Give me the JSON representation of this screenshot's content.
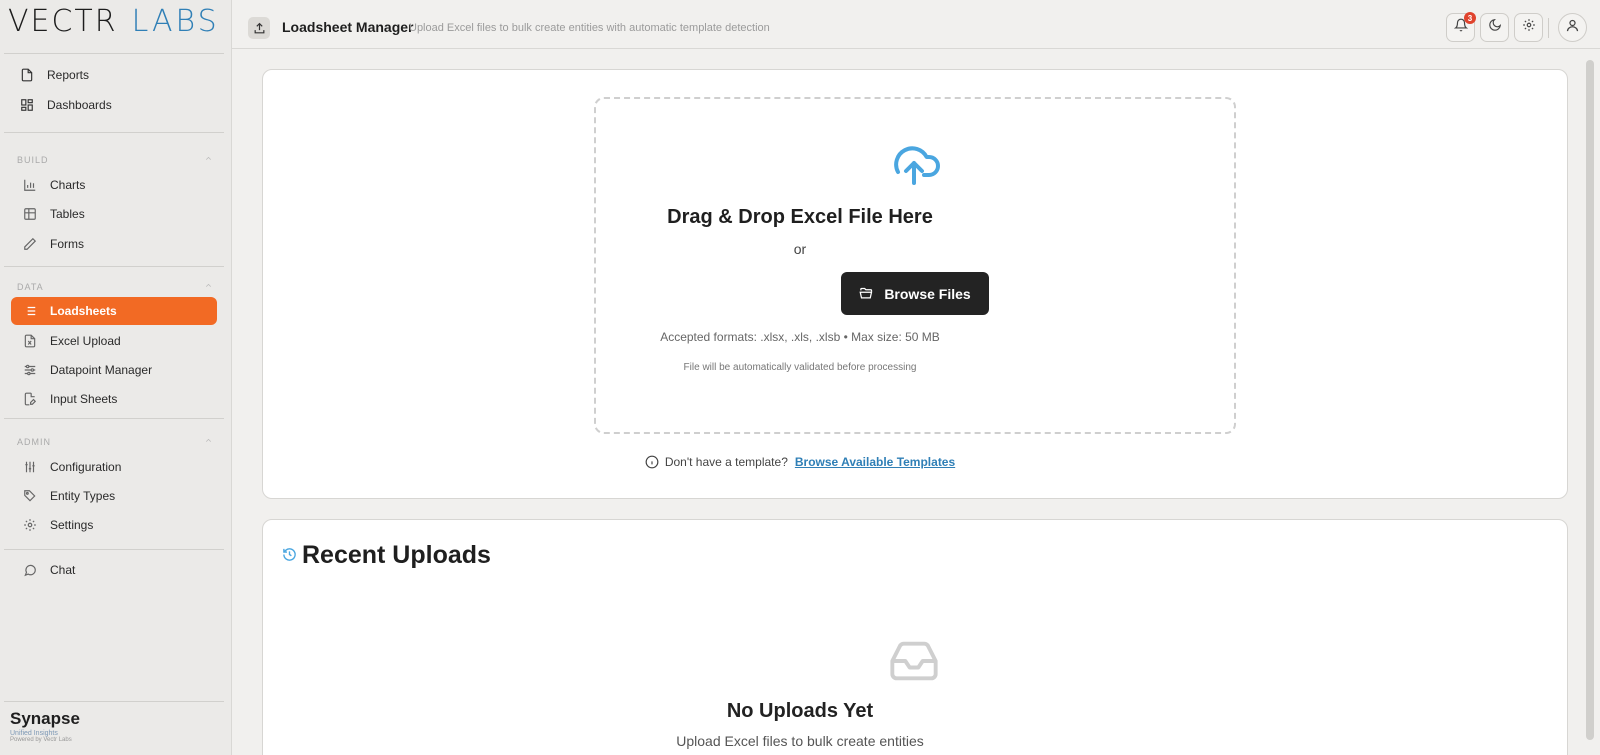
{
  "brand": {
    "logo_part1": "VECTR",
    "logo_part2": "LABS",
    "app_name": "Synapse",
    "tagline": "Unified Insights",
    "powered_by": "Powered by Vectr Labs"
  },
  "sidebar": {
    "top_items": [
      {
        "label": "Reports",
        "icon": "file-icon"
      },
      {
        "label": "Dashboards",
        "icon": "grid-icon"
      }
    ],
    "sections": [
      {
        "title": "BUILD",
        "items": [
          {
            "label": "Charts",
            "icon": "bar-chart-icon"
          },
          {
            "label": "Tables",
            "icon": "table-icon"
          },
          {
            "label": "Forms",
            "icon": "pencil-icon"
          }
        ]
      },
      {
        "title": "DATA",
        "items": [
          {
            "label": "Loadsheets",
            "icon": "list-icon",
            "active": true
          },
          {
            "label": "Excel Upload",
            "icon": "excel-file-icon"
          },
          {
            "label": "Datapoint Manager",
            "icon": "sliders-icon"
          },
          {
            "label": "Input Sheets",
            "icon": "edit-file-icon"
          }
        ]
      },
      {
        "title": "ADMIN",
        "items": [
          {
            "label": "Configuration",
            "icon": "sliders-vertical-icon"
          },
          {
            "label": "Entity Types",
            "icon": "tag-icon"
          },
          {
            "label": "Settings",
            "icon": "gear-icon"
          }
        ]
      }
    ],
    "bottom_items": [
      {
        "label": "Chat",
        "icon": "chat-icon"
      }
    ]
  },
  "header": {
    "title": "Loadsheet Manager",
    "subtitle": "Upload Excel files to bulk create entities with automatic template detection",
    "notification_count": "3"
  },
  "upload": {
    "title": "Drag & Drop Excel File Here",
    "or_text": "or",
    "browse_label": "Browse Files",
    "accepted_formats": "Accepted formats: .xlsx, .xls, .xlsb • Max size: 50 MB",
    "validation_note": "File will be automatically validated before processing",
    "template_prompt": "Don't have a template?",
    "template_link": "Browse Available Templates"
  },
  "recent": {
    "title": "Recent Uploads",
    "empty_title": "No Uploads Yet",
    "empty_subtitle": "Upload Excel files to bulk create entities"
  },
  "colors": {
    "accent": "#f26a24",
    "link": "#2f7fb6",
    "dark_button": "#232323",
    "icon_blue": "#4aa6e0"
  }
}
